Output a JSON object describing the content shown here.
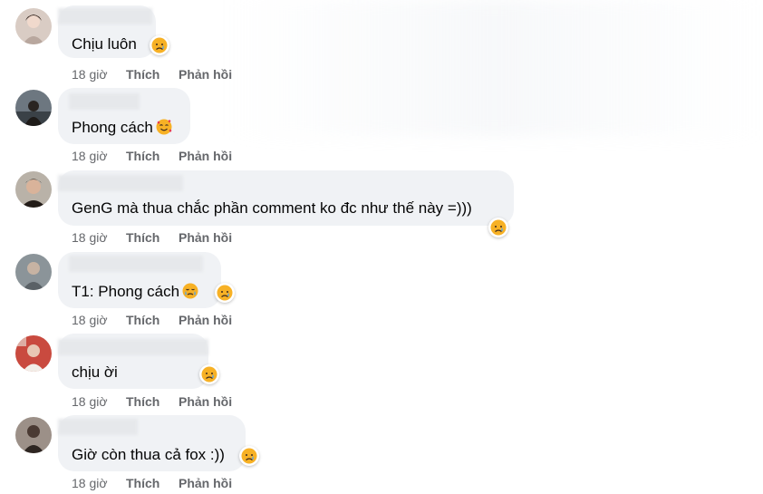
{
  "actions": {
    "like_label": "Thích",
    "reply_label": "Phản hồi"
  },
  "comments": [
    {
      "time": "18 giờ",
      "text": "Chịu luôn",
      "inline_emoji": "",
      "reaction_icon": "sad-crying-face-icon"
    },
    {
      "time": "18 giờ",
      "text": "Phong cách",
      "inline_emoji": "smiling-face-with-hearts-icon",
      "reaction_icon": ""
    },
    {
      "time": "18 giờ",
      "text": "GenG mà thua chắc phần comment ko đc như thế này =)))",
      "inline_emoji": "",
      "reaction_icon": "sad-crying-face-icon"
    },
    {
      "time": "18 giờ",
      "text": "T1: Phong cách",
      "inline_emoji": "crying-face-icon",
      "reaction_icon": "sad-crying-face-icon"
    },
    {
      "time": "18 giờ",
      "text": "chịu ời",
      "inline_emoji": "",
      "reaction_icon": "sad-crying-face-icon"
    },
    {
      "time": "18 giờ",
      "text": "Giờ còn thua cả fox :))",
      "inline_emoji": "",
      "reaction_icon": "sad-crying-face-icon"
    }
  ],
  "colors": {
    "bubble": "#f0f2f5",
    "text": "#050505",
    "meta": "#65676b"
  }
}
